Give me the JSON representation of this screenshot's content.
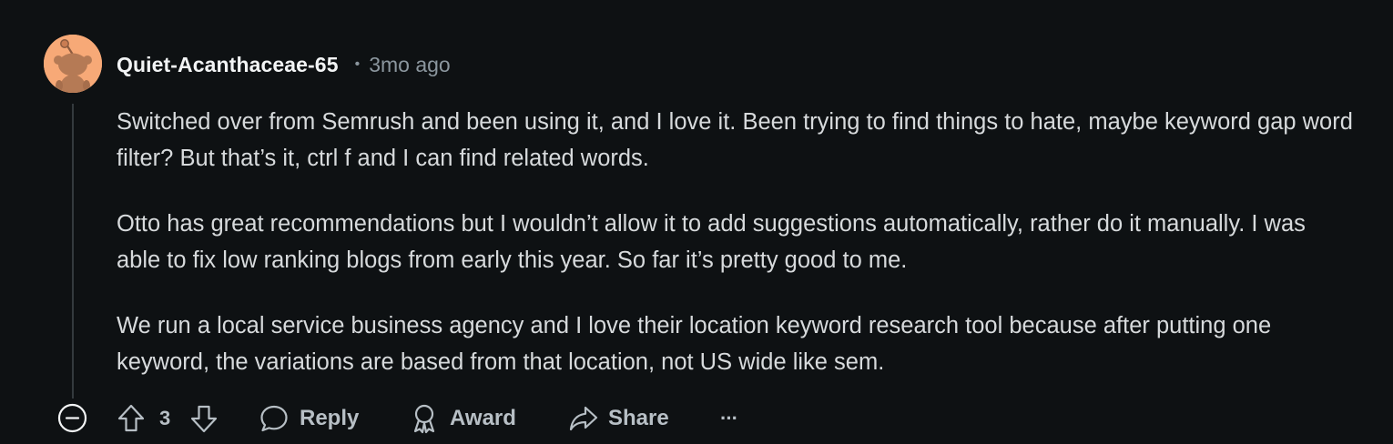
{
  "comment": {
    "username": "Quiet-Acanthaceae-65",
    "separator": "•",
    "timestamp": "3mo ago",
    "avatar_color": "#f7a977",
    "paragraphs": [
      "Switched over from Semrush and been using it, and I love it. Been trying to find things to hate, maybe keyword gap word filter? But that’s it, ctrl f and I can find related words.",
      "Otto has great recommendations but I wouldn’t allow it to add suggestions automatically, rather do it manually. I was able to fix low ranking blogs from early this year. So far it’s pretty good to me.",
      "We run a local service business agency and I love their location keyword research tool because after putting one keyword, the variations are based from that location, not US wide like sem."
    ]
  },
  "actions": {
    "vote_count": "3",
    "reply_label": "Reply",
    "award_label": "Award",
    "share_label": "Share",
    "more_label": "···"
  },
  "icons": {
    "collapse": "minus-circle-icon",
    "upvote": "arrow-up-icon",
    "downvote": "arrow-down-icon",
    "reply": "speech-bubble-icon",
    "award": "award-ribbon-icon",
    "share": "share-arrow-icon",
    "more": "ellipsis-icon"
  },
  "colors": {
    "background": "#0e1113",
    "text": "#d7dadc",
    "muted": "#8b969e",
    "action": "#b7bfc5"
  }
}
